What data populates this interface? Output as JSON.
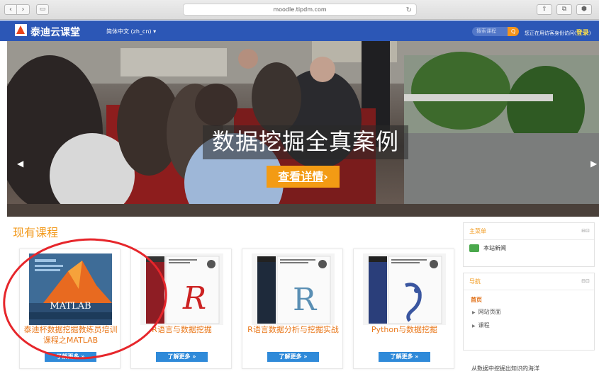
{
  "browser": {
    "url": "moodle.tipdm.com",
    "nav_back_icon": "‹",
    "nav_forward_icon": "›",
    "tabs_icon": "▭",
    "reload_icon": "↻",
    "share_icon": "⇪",
    "tabs_overview_icon": "⧉",
    "extension_icon": "⬢"
  },
  "header": {
    "site_name": "泰迪云课堂",
    "language": "简体中文 (zh_cn) ▾",
    "search_placeholder": "搜索课程",
    "search_icon": "Q",
    "guest_notice": "您正在用访客身份访问(",
    "login_label": "登录",
    "guest_notice_end": ")"
  },
  "hero": {
    "title": "数据挖掘全真案例",
    "button_label": "查看详情",
    "button_arrow": "›",
    "prev_icon": "◀",
    "next_icon": "▶"
  },
  "courses": {
    "section_title": "现有课程",
    "items": [
      {
        "name": "泰迪杯数据挖掘教练员培训课程之MATLAB",
        "button": "了解更多 »",
        "cover": "MATLAB"
      },
      {
        "name": "R语言与数据挖掘",
        "button": "了解更多 »",
        "cover": "R"
      },
      {
        "name": "R语言数据分析与挖掘实战",
        "button": "了解更多 »",
        "cover": "R"
      },
      {
        "name": "Python与数据挖掘",
        "button": "了解更多 »",
        "cover": "Python"
      }
    ]
  },
  "sidebar": {
    "main_menu": {
      "title": "主菜单",
      "controls": "⊟⊡",
      "items": [
        "本站新闻"
      ]
    },
    "navigation": {
      "title": "导航",
      "controls": "⊟⊡",
      "home": "首页",
      "items": [
        "网站页面",
        "课程"
      ]
    },
    "slogan": "从数据中挖掘出知识的海洋"
  },
  "colors": {
    "header_bg": "#2c57b6",
    "accent_orange": "#f29a1d",
    "button_blue": "#2f8ad9",
    "highlight_circle": "#e6262b"
  }
}
